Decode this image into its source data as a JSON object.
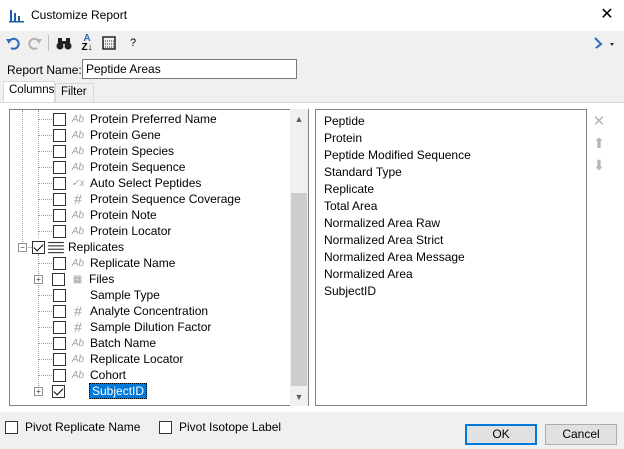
{
  "window": {
    "title": "Customize Report",
    "close_glyph": "✕"
  },
  "toolbar": {
    "undo_icon": "undo-icon",
    "redo_icon": "redo-icon",
    "find_icon": "binoculars-icon",
    "sort_icon": "sort-az-icon",
    "columns_icon": "table-view-icon",
    "help_label": "?",
    "share_icon": "share-icon"
  },
  "report_name": {
    "label": "Report Name:",
    "value": "Peptide Areas"
  },
  "tabs": [
    {
      "label": "Columns"
    },
    {
      "label": "Filter"
    }
  ],
  "tree": {
    "items": [
      {
        "label": "Protein Preferred Name",
        "icon": "Ab",
        "checked": false
      },
      {
        "label": "Protein Gene",
        "icon": "Ab",
        "checked": false
      },
      {
        "label": "Protein Species",
        "icon": "Ab",
        "checked": false
      },
      {
        "label": "Protein Sequence",
        "icon": "Ab",
        "checked": false
      },
      {
        "label": "Auto Select Peptides",
        "icon": "✓x",
        "checked": false
      },
      {
        "label": "Protein Sequence Coverage",
        "icon": "#",
        "checked": false
      },
      {
        "label": "Protein Note",
        "icon": "Ab",
        "checked": false
      },
      {
        "label": "Protein Locator",
        "icon": "Ab",
        "checked": false
      },
      {
        "label": "Replicates",
        "icon": "list",
        "checked": true
      },
      {
        "label": "Replicate Name",
        "icon": "Ab",
        "checked": false
      },
      {
        "label": "Files",
        "icon": "grid",
        "checked": false
      },
      {
        "label": "Sample Type",
        "icon": "",
        "checked": false
      },
      {
        "label": "Analyte Concentration",
        "icon": "#",
        "checked": false
      },
      {
        "label": "Sample Dilution Factor",
        "icon": "#",
        "checked": false
      },
      {
        "label": "Batch Name",
        "icon": "Ab",
        "checked": false
      },
      {
        "label": "Replicate Locator",
        "icon": "Ab",
        "checked": false
      },
      {
        "label": "Cohort",
        "icon": "Ab",
        "checked": false
      },
      {
        "label": "SubjectID",
        "icon": "",
        "checked": true
      }
    ]
  },
  "selected_columns": [
    "Peptide",
    "Protein",
    "Peptide Modified Sequence",
    "Standard Type",
    "Replicate",
    "Total Area",
    "Normalized Area Raw",
    "Normalized Area Strict",
    "Normalized Area Message",
    "Normalized Area",
    "SubjectID"
  ],
  "side_buttons": {
    "remove": "✕",
    "up": "⬆",
    "down": "⬇"
  },
  "options": {
    "pivot_replicate": "Pivot Replicate Name",
    "pivot_isotope": "Pivot Isotope Label"
  },
  "buttons": {
    "ok": "OK",
    "cancel": "Cancel"
  }
}
